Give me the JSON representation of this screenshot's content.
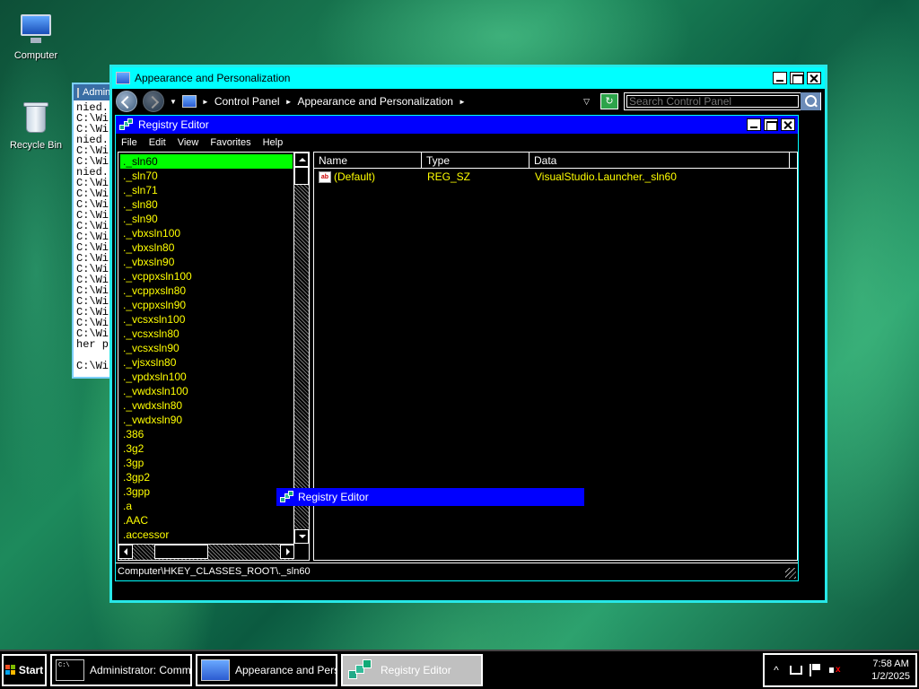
{
  "desktop": {
    "icons": [
      {
        "label": "Computer"
      },
      {
        "label": "Recycle Bin"
      }
    ]
  },
  "cmd_window": {
    "title": "Administrator: Command Prompt",
    "lines": [
      "nied.",
      "C:\\Wi",
      "C:\\Wi",
      "nied.",
      "C:\\Wi",
      "C:\\Wi",
      "nied.",
      "C:\\Wi",
      "C:\\Wi",
      "C:\\Wi",
      "C:\\Wi",
      "C:\\Wi",
      "C:\\Wi",
      "C:\\Wi",
      "C:\\Wi",
      "C:\\Wi",
      "C:\\Wi",
      "C:\\Wi",
      "C:\\Wi",
      "C:\\Wi",
      "C:\\Wi",
      "C:\\Wi",
      "her p",
      "",
      "C:\\Wi"
    ]
  },
  "appearance_window": {
    "title": "Appearance and Personalization",
    "breadcrumbs": [
      "Control Panel",
      "Appearance and Personalization"
    ],
    "search_placeholder": "Search Control Panel"
  },
  "registry_window": {
    "title": "Registry Editor",
    "menu": [
      "File",
      "Edit",
      "View",
      "Favorites",
      "Help"
    ],
    "tree_items": [
      "._sln60",
      "._sln70",
      "._sln71",
      "._sln80",
      "._sln90",
      "._vbxsln100",
      "._vbxsln80",
      "._vbxsln90",
      "._vcppxsln100",
      "._vcppxsln80",
      "._vcppxsln90",
      "._vcsxsln100",
      "._vcsxsln80",
      "._vcsxsln90",
      "._vjsxsln80",
      "._vpdxsln100",
      "._vwdxsln100",
      "._vwdxsln80",
      "._vwdxsln90",
      ".386",
      ".3g2",
      ".3gp",
      ".3gp2",
      ".3gpp",
      ".a",
      ".AAC",
      ".accessor"
    ],
    "selected_index": 0,
    "columns": {
      "name": "Name",
      "type": "Type",
      "data": "Data"
    },
    "values": [
      {
        "name": "(Default)",
        "type": "REG_SZ",
        "data": "VisualStudio.Launcher._sln60"
      }
    ],
    "status": "Computer\\HKEY_CLASSES_ROOT\\._sln60"
  },
  "drag_tooltip": {
    "label": "Registry Editor"
  },
  "taskbar": {
    "start_label": "Start",
    "tasks": [
      {
        "label": "Administrator: Comma..."
      },
      {
        "label": "Appearance and Pers..."
      },
      {
        "label": "Registry Editor"
      }
    ],
    "clock": {
      "time": "7:58 AM",
      "date": "1/2/2025"
    }
  }
}
